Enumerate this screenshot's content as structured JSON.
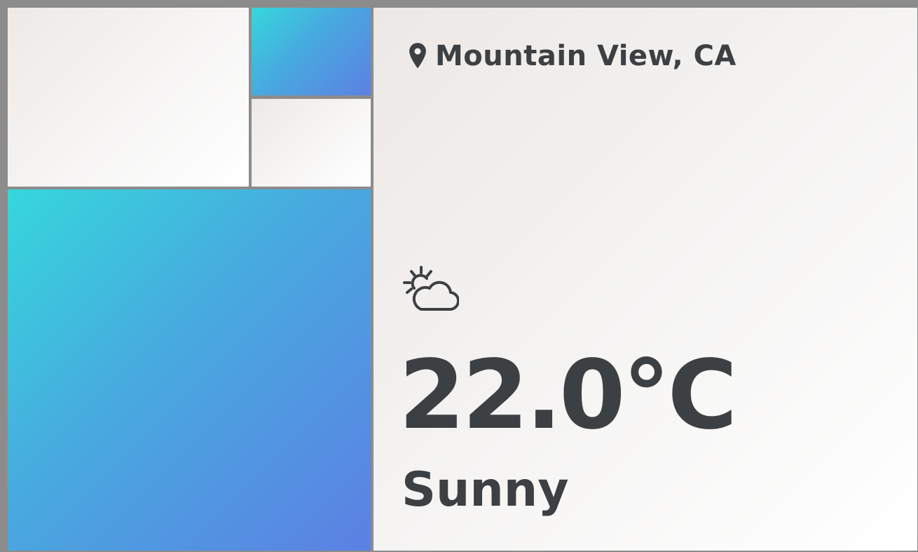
{
  "weather": {
    "location": "Mountain View, CA",
    "temperature": "22.0°C",
    "condition": "Sunny",
    "condition_icon": "partly-cloudy-icon",
    "location_icon": "map-pin-icon"
  },
  "colors": {
    "text": "#3d4043",
    "frame": "#8c8c8c",
    "gradient_start": "#35d7dc",
    "gradient_end": "#5c80e3",
    "panel_light": "#f5f4f3"
  }
}
